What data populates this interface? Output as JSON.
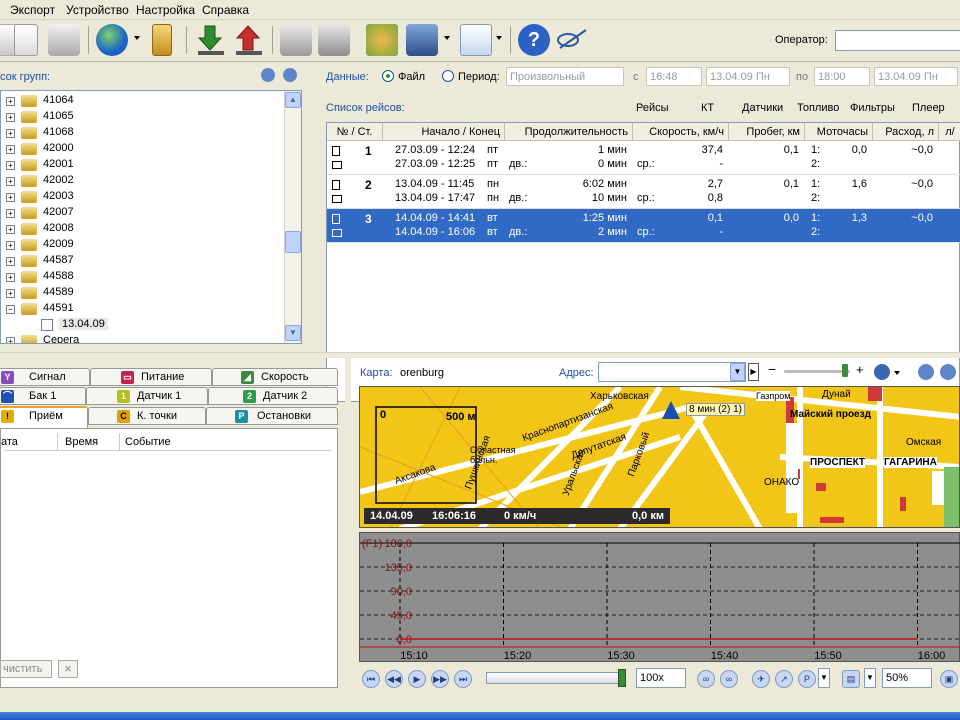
{
  "menu": [
    "Экспорт",
    "Устройство",
    "Настройка",
    "Справка"
  ],
  "toolbar": {
    "operator_label": "Оператор:",
    "operator_value": ""
  },
  "groups": {
    "title": "сок групп:",
    "items": [
      "41064",
      "41065",
      "41068",
      "42000",
      "42001",
      "42002",
      "42003",
      "42007",
      "42008",
      "42009",
      "44587",
      "44588",
      "44589",
      "44591"
    ],
    "child": "13.04.09",
    "last": "Серега"
  },
  "data_filter": {
    "label": "Данные:",
    "file_label": "Файл",
    "period_label": "Период:",
    "period_value": "Произвольный",
    "from_label": "с",
    "from_time": "16:48",
    "from_date": "13.04.09 Пн",
    "to_label": "по",
    "to_time": "18:00",
    "to_date": "13.04.09 Пн"
  },
  "trips": {
    "title": "Список рейсов:",
    "tabs": [
      "Рейсы",
      "КТ",
      "Датчики",
      "Топливо",
      "Фильтры",
      "Плеер"
    ],
    "columns": [
      "№ / Ст.",
      "Начало / Конец",
      "Продолжительность",
      "Скорость, км/ч",
      "Пробег, км",
      "Моточасы",
      "Расход, л",
      "л/"
    ],
    "rows": [
      {
        "num": "1",
        "start": "27.03.09 - 12:24",
        "start_day": "пт",
        "end": "27.03.09 - 12:25",
        "end_day": "пт",
        "dur": "1 мин",
        "dv_label": "дв.:",
        "dv": "0 мин",
        "speed": "37,4",
        "sr_label": "ср.:",
        "sr": "-",
        "mileage": "0,1",
        "m1": "1:",
        "m1v": "0,0",
        "m2": "2:",
        "m2v": "",
        "fuel": "~0,0"
      },
      {
        "num": "2",
        "start": "13.04.09 - 11:45",
        "start_day": "пн",
        "end": "13.04.09 - 17:47",
        "end_day": "пн",
        "dur": "6:02 мин",
        "dv_label": "дв.:",
        "dv": "10 мин",
        "speed": "2,7",
        "sr_label": "ср.:",
        "sr": "0,8",
        "mileage": "0,1",
        "m1": "1:",
        "m1v": "1,6",
        "m2": "2:",
        "m2v": "",
        "fuel": "~0,0"
      },
      {
        "num": "3",
        "start": "14.04.09 - 14:41",
        "start_day": "вт",
        "end": "14.04.09 - 16:06",
        "end_day": "вт",
        "dur": "1:25 мин",
        "dv_label": "дв.:",
        "dv": "2 мин",
        "speed": "0,1",
        "sr_label": "ср.:",
        "sr": "-",
        "mileage": "0,0",
        "m1": "1:",
        "m1v": "1,3",
        "m2": "2:",
        "m2v": "",
        "fuel": "~0,0"
      }
    ]
  },
  "bottom_tabs": {
    "row1": [
      "Сигнал",
      "Питание",
      "Скорость"
    ],
    "row2": [
      "Бак 1",
      "Датчик 1",
      "Датчик 2"
    ],
    "row3": [
      "Приём",
      "К. точки",
      "Остановки"
    ],
    "icons_row2": [
      "",
      "1",
      "2"
    ],
    "icons_row3": [
      "!",
      "C",
      "P"
    ]
  },
  "events": {
    "columns": [
      "ата",
      "Время",
      "Событие"
    ],
    "clear_label": "чистить",
    "close": "×"
  },
  "map": {
    "label": "Карта:",
    "name": "orenburg",
    "address_label": "Адрес:",
    "scale_zero": "0",
    "scale_value": "500 м",
    "vehicle_label": "8 мин (2)",
    "vehicle_sub": "1)",
    "status_date": "14.04.09",
    "status_time": "16:06:16",
    "status_speed": "0 км/ч",
    "status_dist": "0,0 км",
    "streets": [
      "Харьковская",
      "Краснопартизанская",
      "Депутатская",
      "Майский проезд",
      "Дунай",
      "Газпром",
      "Омская",
      "ПРОСПЕКТ",
      "ГАГАРИНА",
      "ОНАКО",
      "Аксакова",
      "Пушкинская",
      "Уральская",
      "Парковый",
      "Областная больн."
    ]
  },
  "chart_data": {
    "type": "line",
    "series_label": "(F1)",
    "y_ticks": [
      "180,0",
      "135,0",
      "90,0",
      "45,0",
      "0,0"
    ],
    "ylim": [
      0,
      180
    ],
    "x_ticks": [
      "15:10",
      "15:20",
      "15:30",
      "15:40",
      "15:50",
      "16:00"
    ],
    "series": [
      {
        "values": [
          0,
          0,
          0,
          0,
          0,
          0
        ]
      }
    ],
    "grid": true
  },
  "player": {
    "speed": "100x",
    "zoom": "50%"
  }
}
